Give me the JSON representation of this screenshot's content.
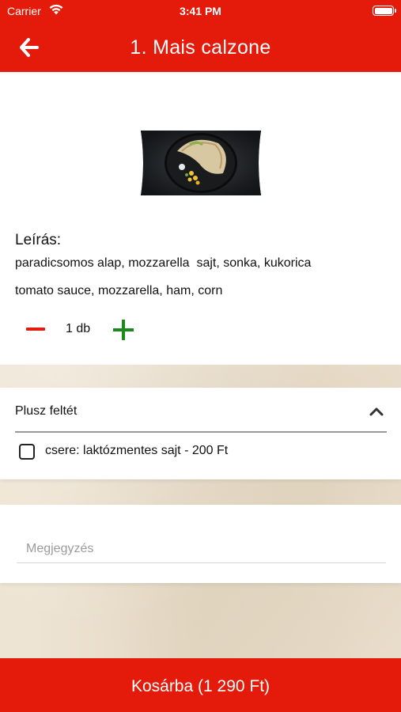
{
  "status_bar": {
    "carrier": "Carrier",
    "time": "3:41 PM",
    "wifi_icon": "wifi-icon",
    "battery_icon": "battery-icon"
  },
  "header": {
    "title": "1. Mais calzone",
    "back_icon": "arrow-left-icon",
    "color": "#e41a0a"
  },
  "product": {
    "image_icon": "calzone-photo",
    "description_heading": "Leírás:",
    "description_hu": "paradicsomos alap, mozzarella  sajt, sonka, kukorica",
    "description_en": "tomato sauce, mozzarella, ham, corn"
  },
  "quantity": {
    "value": "1 db",
    "minus_icon": "minus-icon",
    "plus_icon": "plus-icon",
    "minus_color": "#e41a0a",
    "plus_color": "#1a8a1a"
  },
  "extras": {
    "title": "Plusz feltét",
    "expanded_icon": "chevron-up-icon",
    "options": [
      {
        "label": "csere: laktózmentes sajt - 200 Ft",
        "checked": false
      }
    ]
  },
  "note": {
    "placeholder": "Megjegyzés",
    "value": ""
  },
  "cart_button": {
    "label": "Kosárba (1 290 Ft)"
  }
}
